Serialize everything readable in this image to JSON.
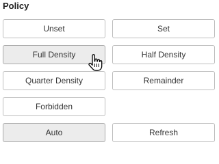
{
  "policy": {
    "title": "Policy",
    "buttons": {
      "unset": "Unset",
      "set": "Set",
      "full_density": "Full Density",
      "half_density": "Half Density",
      "quarter_density": "Quarter Density",
      "remainder": "Remainder",
      "forbidden": "Forbidden",
      "auto": "Auto",
      "refresh": "Refresh"
    }
  },
  "cursor": {
    "icon": "hand-pointer-icon"
  }
}
